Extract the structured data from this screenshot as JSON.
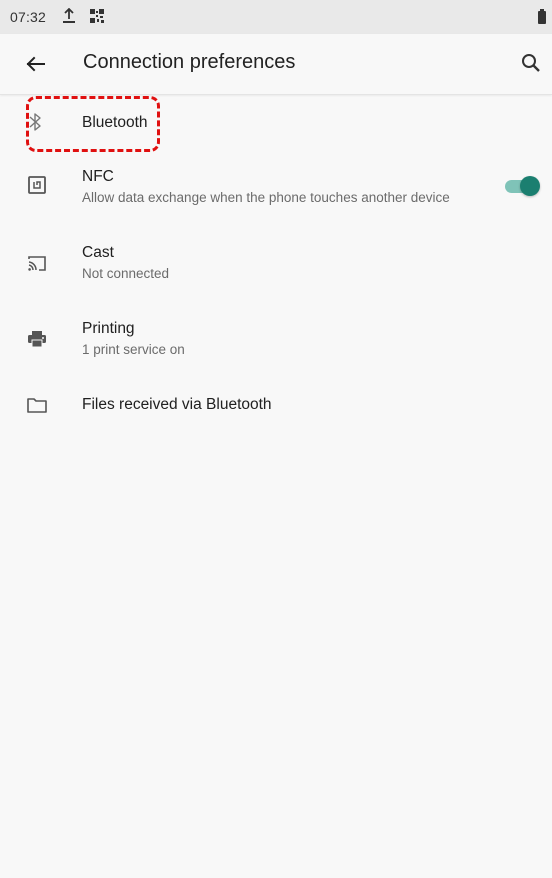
{
  "status_bar": {
    "time": "07:32",
    "icons": [
      "upload-icon",
      "qr-code-icon",
      "battery-icon"
    ]
  },
  "app_bar": {
    "title": "Connection preferences",
    "back_icon": "arrow-back-icon",
    "search_icon": "search-icon"
  },
  "items": [
    {
      "title": "Bluetooth",
      "summary": "",
      "icon": "bluetooth-icon"
    },
    {
      "title": "NFC",
      "summary": "Allow data exchange when the phone touches another device",
      "icon": "nfc-icon",
      "toggle": "on"
    },
    {
      "title": "Cast",
      "summary": "Not connected",
      "icon": "cast-icon"
    },
    {
      "title": "Printing",
      "summary": "1 print service on",
      "icon": "printer-icon"
    },
    {
      "title": "Files received via Bluetooth",
      "summary": "",
      "icon": "folder-icon"
    }
  ],
  "colors": {
    "background": "#f8f8f8",
    "status_bar": "#e9e9e9",
    "toggle_thumb": "#1b7f70",
    "toggle_track": "#7fc3b8",
    "highlight": "#e01010"
  }
}
